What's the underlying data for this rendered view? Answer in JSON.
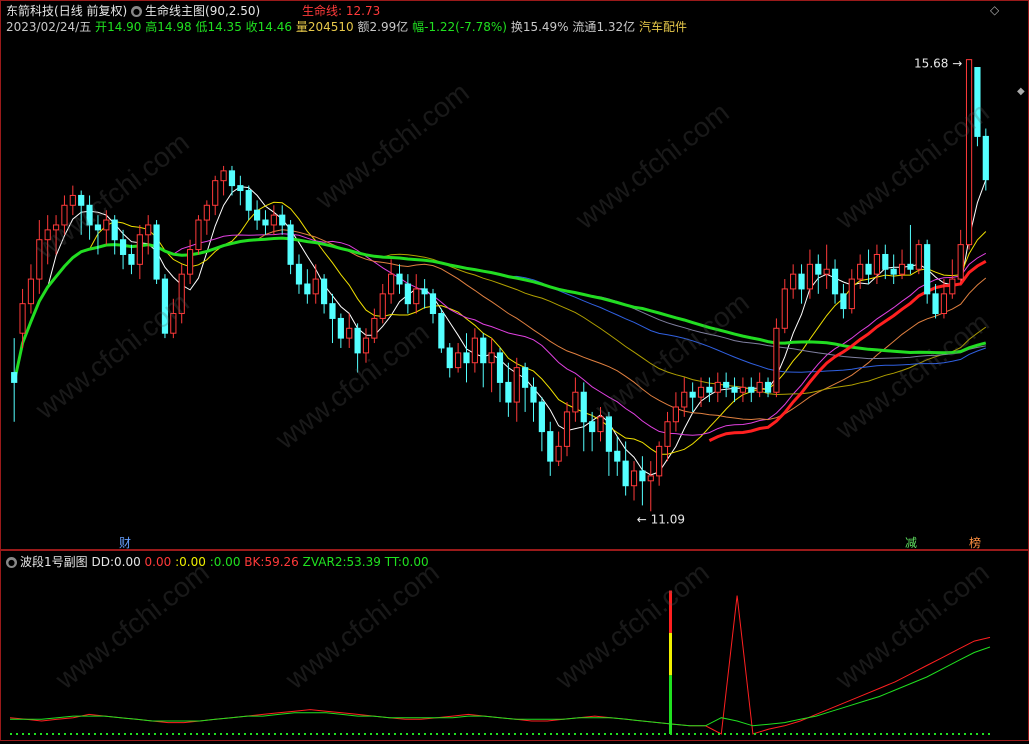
{
  "stock": {
    "name": "东箭科技",
    "period": "(日线 前复权)",
    "main_indicator": "生命线主图(90,2.50)",
    "lifeline_label": "生命线:",
    "lifeline_value": "12.73",
    "date": "2023/02/24/五",
    "open_label": "开",
    "open": "14.90",
    "high_label": "高",
    "high": "14.98",
    "low_label": "低",
    "low": "14.35",
    "close_label": "收",
    "close": "14.46",
    "volume_label": "量",
    "volume": "204510",
    "amount_label": "额",
    "amount": "2.99亿",
    "change_label": "幅",
    "change": "-1.22(-7.78%)",
    "turnover_label": "换",
    "turnover": "15.49%",
    "float_label": "流通",
    "float": "1.32亿",
    "sector": "汽车配件"
  },
  "annotations": {
    "max_label": "15.68",
    "min_label": "11.09",
    "cai": "财",
    "jian": "减",
    "bang": "榜"
  },
  "sub_indicator": {
    "name": "波段1号副图",
    "dd_label": "DD:",
    "dd": "0.00",
    "v1": "0.00",
    "v2_label": ":",
    "v2": "0.00",
    "v3_label": ":",
    "v3": "0.00",
    "bk_label": "BK:",
    "bk": "59.26",
    "zvar2_label": "ZVAR2:",
    "zvar2": "53.39",
    "tt_label": "TT:",
    "tt": "0.00"
  },
  "watermark": "www.cfchi.com",
  "colors": {
    "up": "#ff3a3a",
    "down": "#54ffff",
    "lifeline": "#22dd22",
    "red_line": "#ff2020",
    "frame": "#9a1a1a"
  },
  "chart_data": [
    {
      "type": "candlestick",
      "title": "东箭科技 (日线 前复权)",
      "ylim": [
        10.9,
        15.9
      ],
      "candles": [
        [
          12.5,
          12.4,
          12.85,
          12.0
        ],
        [
          12.9,
          13.2,
          13.35,
          12.75
        ],
        [
          13.2,
          13.45,
          13.6,
          13.1
        ],
        [
          13.45,
          13.85,
          14.05,
          13.3
        ],
        [
          13.85,
          13.95,
          14.1,
          13.6
        ],
        [
          13.95,
          14.0,
          14.1,
          13.7
        ],
        [
          14.0,
          14.2,
          14.3,
          13.9
        ],
        [
          14.2,
          14.3,
          14.4,
          14.1
        ],
        [
          14.3,
          14.2,
          14.35,
          13.9
        ],
        [
          14.2,
          14.0,
          14.3,
          13.85
        ],
        [
          14.0,
          13.95,
          14.1,
          13.7
        ],
        [
          13.95,
          14.05,
          14.15,
          13.8
        ],
        [
          14.05,
          13.85,
          14.1,
          13.7
        ],
        [
          13.85,
          13.7,
          13.95,
          13.55
        ],
        [
          13.7,
          13.6,
          13.8,
          13.5
        ],
        [
          13.6,
          13.9,
          14.0,
          13.45
        ],
        [
          13.9,
          14.0,
          14.1,
          13.7
        ],
        [
          14.0,
          13.45,
          14.05,
          13.4
        ],
        [
          13.45,
          12.9,
          13.5,
          12.85
        ],
        [
          12.9,
          13.1,
          13.25,
          12.85
        ],
        [
          13.1,
          13.5,
          13.6,
          13.0
        ],
        [
          13.5,
          13.75,
          13.85,
          13.4
        ],
        [
          13.75,
          14.05,
          14.1,
          13.7
        ],
        [
          14.05,
          14.2,
          14.25,
          13.9
        ],
        [
          14.2,
          14.45,
          14.5,
          14.1
        ],
        [
          14.45,
          14.55,
          14.6,
          14.3
        ],
        [
          14.55,
          14.4,
          14.6,
          14.3
        ],
        [
          14.4,
          14.35,
          14.5,
          14.2
        ],
        [
          14.35,
          14.15,
          14.4,
          14.05
        ],
        [
          14.15,
          14.05,
          14.25,
          13.95
        ],
        [
          14.05,
          14.0,
          14.15,
          13.9
        ],
        [
          14.0,
          14.1,
          14.2,
          13.9
        ],
        [
          14.1,
          14.0,
          14.2,
          13.9
        ],
        [
          14.0,
          13.6,
          14.05,
          13.5
        ],
        [
          13.6,
          13.4,
          13.7,
          13.3
        ],
        [
          13.4,
          13.3,
          13.55,
          13.2
        ],
        [
          13.3,
          13.45,
          13.6,
          13.2
        ],
        [
          13.45,
          13.2,
          13.5,
          13.1
        ],
        [
          13.2,
          13.05,
          13.3,
          12.8
        ],
        [
          13.05,
          12.85,
          13.1,
          12.75
        ],
        [
          12.85,
          12.95,
          13.1,
          12.75
        ],
        [
          12.95,
          12.7,
          13.0,
          12.5
        ],
        [
          12.7,
          12.85,
          12.95,
          12.6
        ],
        [
          12.85,
          13.05,
          13.15,
          12.8
        ],
        [
          13.05,
          13.3,
          13.4,
          13.0
        ],
        [
          13.3,
          13.5,
          13.65,
          13.2
        ],
        [
          13.5,
          13.4,
          13.6,
          13.3
        ],
        [
          13.4,
          13.2,
          13.5,
          13.1
        ],
        [
          13.2,
          13.35,
          13.5,
          13.1
        ],
        [
          13.35,
          13.3,
          13.45,
          13.15
        ],
        [
          13.3,
          13.1,
          13.35,
          13.0
        ],
        [
          13.1,
          12.75,
          13.15,
          12.7
        ],
        [
          12.75,
          12.55,
          12.8,
          12.45
        ],
        [
          12.55,
          12.7,
          12.8,
          12.5
        ],
        [
          12.7,
          12.6,
          12.9,
          12.4
        ],
        [
          12.6,
          12.85,
          12.95,
          12.5
        ],
        [
          12.85,
          12.6,
          12.9,
          12.35
        ],
        [
          12.6,
          12.7,
          12.85,
          12.3
        ],
        [
          12.7,
          12.4,
          12.75,
          12.2
        ],
        [
          12.4,
          12.2,
          12.6,
          12.05
        ],
        [
          12.2,
          12.55,
          12.65,
          12.0
        ],
        [
          12.55,
          12.35,
          12.6,
          12.1
        ],
        [
          12.35,
          12.2,
          12.45,
          12.0
        ],
        [
          12.2,
          11.9,
          12.25,
          11.7
        ],
        [
          11.9,
          11.6,
          12.0,
          11.45
        ],
        [
          11.6,
          11.75,
          11.9,
          11.55
        ],
        [
          11.75,
          12.1,
          12.2,
          11.65
        ],
        [
          12.1,
          12.3,
          12.45,
          12.0
        ],
        [
          12.3,
          12.0,
          12.4,
          11.7
        ],
        [
          12.0,
          11.9,
          12.1,
          11.7
        ],
        [
          11.9,
          12.05,
          12.15,
          11.8
        ],
        [
          12.05,
          11.7,
          12.1,
          11.45
        ],
        [
          11.7,
          11.6,
          11.85,
          11.45
        ],
        [
          11.6,
          11.35,
          11.8,
          11.25
        ],
        [
          11.35,
          11.5,
          11.6,
          11.2
        ],
        [
          11.5,
          11.4,
          11.65,
          11.15
        ],
        [
          11.4,
          11.45,
          11.6,
          11.09
        ],
        [
          11.45,
          11.75,
          11.8,
          11.35
        ],
        [
          11.75,
          12.0,
          12.1,
          11.6
        ],
        [
          12.0,
          12.15,
          12.3,
          11.9
        ],
        [
          12.15,
          12.3,
          12.45,
          12.05
        ],
        [
          12.3,
          12.25,
          12.4,
          12.1
        ],
        [
          12.25,
          12.35,
          12.45,
          12.15
        ],
        [
          12.35,
          12.3,
          12.45,
          12.2
        ],
        [
          12.3,
          12.4,
          12.5,
          12.2
        ],
        [
          12.4,
          12.35,
          12.5,
          12.25
        ],
        [
          12.35,
          12.3,
          12.45,
          12.2
        ],
        [
          12.3,
          12.35,
          12.45,
          12.2
        ],
        [
          12.35,
          12.3,
          12.45,
          12.2
        ],
        [
          12.3,
          12.4,
          12.5,
          12.25
        ],
        [
          12.4,
          12.3,
          12.45,
          12.25
        ],
        [
          12.3,
          12.95,
          13.05,
          12.25
        ],
        [
          12.95,
          13.35,
          13.45,
          12.9
        ],
        [
          13.35,
          13.5,
          13.6,
          13.25
        ],
        [
          13.5,
          13.35,
          13.6,
          13.2
        ],
        [
          13.35,
          13.6,
          13.75,
          13.25
        ],
        [
          13.6,
          13.5,
          13.7,
          13.3
        ],
        [
          13.5,
          13.55,
          13.8,
          13.35
        ],
        [
          13.55,
          13.3,
          13.65,
          13.2
        ],
        [
          13.3,
          13.15,
          13.4,
          13.05
        ],
        [
          13.15,
          13.45,
          13.55,
          13.1
        ],
        [
          13.45,
          13.6,
          13.7,
          13.35
        ],
        [
          13.6,
          13.5,
          13.75,
          13.4
        ],
        [
          13.5,
          13.7,
          13.8,
          13.4
        ],
        [
          13.7,
          13.55,
          13.8,
          13.45
        ],
        [
          13.55,
          13.5,
          13.7,
          13.4
        ],
        [
          13.5,
          13.6,
          13.75,
          13.45
        ],
        [
          13.6,
          13.55,
          14.0,
          13.5
        ],
        [
          13.55,
          13.8,
          13.85,
          13.5
        ],
        [
          13.8,
          13.3,
          13.85,
          13.2
        ],
        [
          13.3,
          13.1,
          13.4,
          13.05
        ],
        [
          13.1,
          13.3,
          13.45,
          13.05
        ],
        [
          13.3,
          13.45,
          13.65,
          13.25
        ],
        [
          13.45,
          13.8,
          13.95,
          13.4
        ],
        [
          13.8,
          15.68,
          15.68,
          13.75
        ],
        [
          15.6,
          14.9,
          15.2,
          14.8
        ],
        [
          14.9,
          14.46,
          14.98,
          14.35
        ]
      ]
    },
    {
      "type": "line",
      "series": [
        {
          "values": [
            10,
            9,
            8,
            9,
            10,
            12,
            11,
            10,
            9,
            8,
            7,
            7,
            8,
            9,
            10,
            11,
            12,
            13,
            14,
            15,
            14,
            13,
            12,
            11,
            10,
            9,
            9,
            10,
            11,
            12,
            11,
            10,
            9,
            8,
            8,
            9,
            10,
            11,
            10,
            9,
            8,
            7,
            6,
            5,
            5,
            0,
            85,
            0,
            3,
            5,
            8,
            12,
            16,
            20,
            24,
            28,
            32,
            37,
            42,
            47,
            52,
            57,
            59.26
          ]
        },
        {
          "values": [
            9,
            9,
            9,
            10,
            11,
            11,
            11,
            10,
            9,
            8,
            8,
            8,
            8,
            9,
            10,
            11,
            11,
            12,
            13,
            13,
            13,
            12,
            11,
            11,
            10,
            10,
            10,
            10,
            10,
            11,
            11,
            10,
            9,
            9,
            9,
            9,
            10,
            10,
            10,
            9,
            8,
            7,
            6,
            5,
            5,
            10,
            8,
            5,
            6,
            7,
            9,
            11,
            14,
            17,
            20,
            23,
            27,
            31,
            35,
            40,
            45,
            50,
            53.39
          ]
        }
      ],
      "ylim": [
        0,
        100
      ]
    }
  ]
}
